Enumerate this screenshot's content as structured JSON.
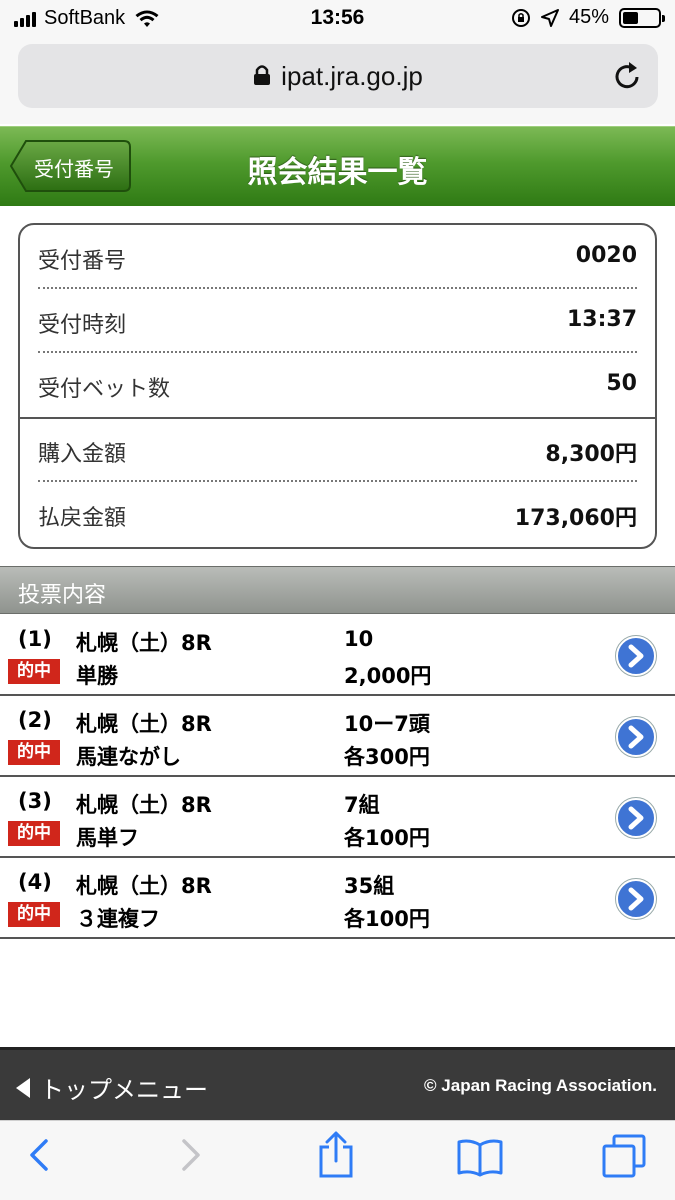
{
  "status_bar": {
    "carrier": "SoftBank",
    "time": "13:56",
    "battery_percent": "45%",
    "battery_level": 0.45
  },
  "browser": {
    "url": "ipat.jra.go.jp"
  },
  "header": {
    "back_label": "受付番号",
    "title": "照会結果一覧",
    "accent_color": "#4f9a2d"
  },
  "receipt": {
    "rows": [
      {
        "label": "受付番号",
        "value": "0020"
      },
      {
        "label": "受付時刻",
        "value": "13:37"
      },
      {
        "label": "受付ベット数",
        "value": "50"
      },
      {
        "label": "購入金額",
        "value": "8,300円"
      },
      {
        "label": "払戻金額",
        "value": "173,060円"
      }
    ]
  },
  "bets": {
    "section_title": "投票内容",
    "hit_label": "的中",
    "items": [
      {
        "num": "(1)",
        "race": "札幌（土）8R",
        "combo": "10",
        "type": "単勝",
        "amount": "2,000円"
      },
      {
        "num": "(2)",
        "race": "札幌（土）8R",
        "combo": "10ー7頭",
        "type": "馬連ながし",
        "amount": "各300円"
      },
      {
        "num": "(3)",
        "race": "札幌（土）8R",
        "combo": "7組",
        "type": "馬単フ",
        "amount": "各100円"
      },
      {
        "num": "(4)",
        "race": "札幌（土）8R",
        "combo": "35組",
        "type": "３連複フ",
        "amount": "各100円"
      }
    ]
  },
  "footer": {
    "top_menu": "トップメニュー",
    "copyright": "© Japan Racing Association."
  }
}
